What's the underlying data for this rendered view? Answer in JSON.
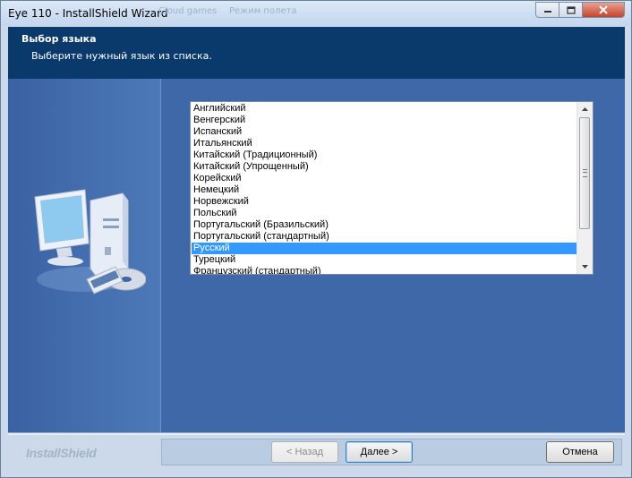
{
  "window": {
    "title": "Eye 110 - InstallShield Wizard",
    "faded_tab_1": "Cloud games",
    "faded_tab_2": "Режим полета",
    "minimize_icon": "minimize-icon",
    "maximize_icon": "maximize-icon",
    "close_icon": "close-icon"
  },
  "header": {
    "title": "Выбор языка",
    "subtitle": "Выберите нужный язык из списка."
  },
  "language_list": {
    "items": [
      "Английский",
      "Венгерский",
      "Испанский",
      "Итальянский",
      "Китайский (Традиционный)",
      "Китайский (Упрощенный)",
      "Корейский",
      "Немецкий",
      "Норвежский",
      "Польский",
      "Португальский (Бразильский)",
      "Португальский (стандартный)",
      "Русский",
      "Турецкий",
      "Французский (стандартный)"
    ],
    "selected": "Русский"
  },
  "footer": {
    "brand": "InstallShield",
    "back_label": "< Назад",
    "next_label": "Далее >",
    "cancel_label": "Отмена"
  },
  "colors": {
    "header_bg": "#0a3a6b",
    "panel_bg": "#3f68a8",
    "selection": "#3399ff"
  }
}
